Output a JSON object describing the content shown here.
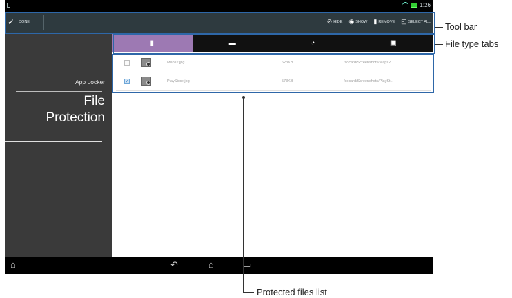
{
  "toolbar": {
    "done_label": "DONE",
    "hide_label": "HIDE",
    "show_label": "SHOW",
    "remove_label": "REMOVE",
    "select_all_label": "SELECT ALL"
  },
  "status": {
    "time": "1:26"
  },
  "sidebar": {
    "app_name": "App Locker",
    "title_line1": "File",
    "title_line2": "Protection"
  },
  "tabs": [
    {
      "icon": "document-icon",
      "glyph": "▮",
      "active": true
    },
    {
      "icon": "image-icon",
      "glyph": "▬",
      "active": false
    },
    {
      "icon": "music-icon",
      "glyph": "◔",
      "active": false
    },
    {
      "icon": "video-icon",
      "glyph": "▣",
      "active": false
    }
  ],
  "files": [
    {
      "name": "Maps2.jpg",
      "size": "623KB",
      "path": "/sdcard/Screenshots/Maps2....",
      "checked": false
    },
    {
      "name": "PlayStore.jpg",
      "size": "573KB",
      "path": "/sdcard/Screenshots/PlaySt...",
      "checked": true
    }
  ],
  "callouts": {
    "toolbar": "Tool bar",
    "tabs": "File type tabs",
    "list": "Protected files list"
  },
  "colors": {
    "active_tab": "#9d79b3",
    "annotation_box": "#2e67a8",
    "toolbar_bg": "#2e3a3f",
    "sidebar_bg": "#3a3a3a"
  }
}
